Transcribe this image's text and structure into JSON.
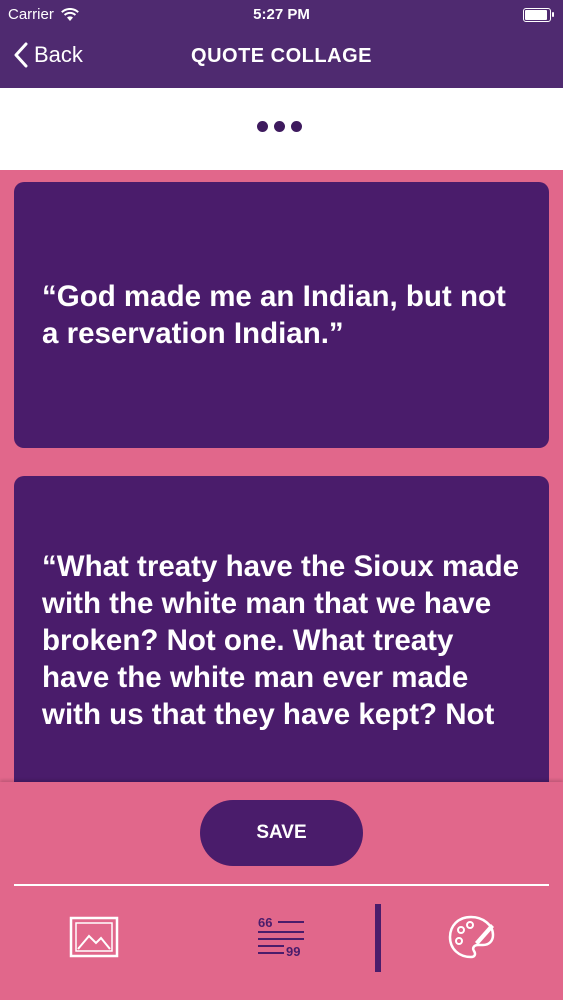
{
  "status_bar": {
    "carrier": "Carrier",
    "time": "5:27 PM"
  },
  "nav": {
    "back_label": "Back",
    "title": "QUOTE COLLAGE"
  },
  "quotes": [
    "“God made me an Indian, but not a reservation Indian.”",
    "“What treaty have the Sioux made with the white man that we have broken? Not one. What treaty have the white man ever made with us that they have kept? Not"
  ],
  "actions": {
    "save_label": "SAVE"
  },
  "toolbar": {
    "icons": [
      "image-icon",
      "quote-text-icon",
      "palette-icon"
    ]
  },
  "colors": {
    "nav": "#4f2a70",
    "card": "#4a1c6b",
    "background": "#e1678b"
  }
}
